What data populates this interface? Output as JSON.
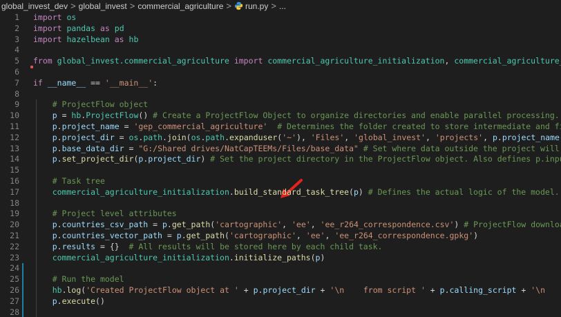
{
  "breadcrumb": {
    "items": [
      "global_invest_dev",
      "global_invest",
      "commercial_agriculture",
      "run.py",
      "..."
    ],
    "separator": ">"
  },
  "editor": {
    "lines": [
      {
        "n": "1",
        "tokens": [
          [
            "kw",
            "import"
          ],
          [
            "pun",
            " "
          ],
          [
            "mod",
            "os"
          ]
        ]
      },
      {
        "n": "2",
        "tokens": [
          [
            "kw",
            "import"
          ],
          [
            "pun",
            " "
          ],
          [
            "mod",
            "pandas"
          ],
          [
            "pun",
            " "
          ],
          [
            "kw",
            "as"
          ],
          [
            "pun",
            " "
          ],
          [
            "mod",
            "pd"
          ]
        ]
      },
      {
        "n": "3",
        "tokens": [
          [
            "kw",
            "import"
          ],
          [
            "pun",
            " "
          ],
          [
            "mod",
            "hazelbean"
          ],
          [
            "pun",
            " "
          ],
          [
            "kw",
            "as"
          ],
          [
            "pun",
            " "
          ],
          [
            "mod",
            "hb"
          ]
        ]
      },
      {
        "n": "4",
        "tokens": []
      },
      {
        "n": "5",
        "tokens": [
          [
            "kw",
            "from"
          ],
          [
            "pun",
            " "
          ],
          [
            "mod",
            "global_invest.commercial_agriculture"
          ],
          [
            "pun",
            " "
          ],
          [
            "kw",
            "import"
          ],
          [
            "pun",
            " "
          ],
          [
            "mod",
            "commercial_agriculture_initialization"
          ],
          [
            "pun",
            ", "
          ],
          [
            "mod",
            "commercial_agriculture_tasks"
          ]
        ]
      },
      {
        "n": "6",
        "tokens": []
      },
      {
        "n": "7",
        "tokens": [
          [
            "kw",
            "if"
          ],
          [
            "pun",
            " "
          ],
          [
            "var",
            "__name__"
          ],
          [
            "pun",
            " == "
          ],
          [
            "str",
            "'__main__'"
          ],
          [
            "pun",
            ":"
          ]
        ]
      },
      {
        "n": "8",
        "tokens": []
      },
      {
        "n": "9",
        "tokens": [
          [
            "pun",
            "    "
          ],
          [
            "cm",
            "# ProjectFlow object"
          ]
        ]
      },
      {
        "n": "10",
        "tokens": [
          [
            "pun",
            "    "
          ],
          [
            "var",
            "p"
          ],
          [
            "pun",
            " = "
          ],
          [
            "mod",
            "hb"
          ],
          [
            "pun",
            "."
          ],
          [
            "cls",
            "ProjectFlow"
          ],
          [
            "pun",
            "() "
          ],
          [
            "cm",
            "# Create a ProjectFlow Object to organize directories and enable parallel processing."
          ]
        ]
      },
      {
        "n": "11",
        "tokens": [
          [
            "pun",
            "    "
          ],
          [
            "var",
            "p"
          ],
          [
            "pun",
            "."
          ],
          [
            "var",
            "project_name"
          ],
          [
            "pun",
            " = "
          ],
          [
            "str",
            "'gep_commercial_agriculture'"
          ],
          [
            "pun",
            "  "
          ],
          [
            "cm",
            "# Determines the folder created to store intermediate and final results."
          ]
        ]
      },
      {
        "n": "12",
        "tokens": [
          [
            "pun",
            "    "
          ],
          [
            "var",
            "p"
          ],
          [
            "pun",
            "."
          ],
          [
            "var",
            "project_dir"
          ],
          [
            "pun",
            " = "
          ],
          [
            "mod",
            "os"
          ],
          [
            "pun",
            "."
          ],
          [
            "mod",
            "path"
          ],
          [
            "pun",
            "."
          ],
          [
            "fn",
            "join"
          ],
          [
            "pun",
            "("
          ],
          [
            "mod",
            "os"
          ],
          [
            "pun",
            "."
          ],
          [
            "mod",
            "path"
          ],
          [
            "pun",
            "."
          ],
          [
            "fn",
            "expanduser"
          ],
          [
            "pun",
            "("
          ],
          [
            "str",
            "'~'"
          ],
          [
            "pun",
            "), "
          ],
          [
            "str",
            "'Files'"
          ],
          [
            "pun",
            ", "
          ],
          [
            "str",
            "'global_invest'"
          ],
          [
            "pun",
            ", "
          ],
          [
            "str",
            "'projects'"
          ],
          [
            "pun",
            ", "
          ],
          [
            "var",
            "p"
          ],
          [
            "pun",
            "."
          ],
          [
            "var",
            "project_name"
          ],
          [
            "pun",
            ") "
          ],
          [
            "cm",
            "# Put it"
          ]
        ]
      },
      {
        "n": "13",
        "tokens": [
          [
            "pun",
            "    "
          ],
          [
            "var",
            "p"
          ],
          [
            "pun",
            "."
          ],
          [
            "var",
            "base_data_dir"
          ],
          [
            "pun",
            " = "
          ],
          [
            "str",
            "\"G:/Shared drives/NatCapTEEMs/Files/base_data\""
          ],
          [
            "pun",
            " "
          ],
          [
            "cm",
            "# Set where data outside the project will be stored."
          ]
        ]
      },
      {
        "n": "14",
        "tokens": [
          [
            "pun",
            "    "
          ],
          [
            "var",
            "p"
          ],
          [
            "pun",
            "."
          ],
          [
            "fn",
            "set_project_dir"
          ],
          [
            "pun",
            "("
          ],
          [
            "var",
            "p"
          ],
          [
            "pun",
            "."
          ],
          [
            "var",
            "project_dir"
          ],
          [
            "pun",
            ") "
          ],
          [
            "cm",
            "# Set the project directory in the ProjectFlow object. Also defines p.input_dir, p"
          ]
        ]
      },
      {
        "n": "15",
        "tokens": []
      },
      {
        "n": "16",
        "tokens": [
          [
            "pun",
            "    "
          ],
          [
            "cm",
            "# Task tree"
          ]
        ]
      },
      {
        "n": "17",
        "tokens": [
          [
            "pun",
            "    "
          ],
          [
            "mod",
            "commercial_agriculture_initialization"
          ],
          [
            "pun",
            "."
          ],
          [
            "fn",
            "build_standard_task_tree"
          ],
          [
            "pun",
            "("
          ],
          [
            "var",
            "p"
          ],
          [
            "pun",
            ") "
          ],
          [
            "cm",
            "# Defines the actual logic of the model. Navigate"
          ]
        ]
      },
      {
        "n": "18",
        "tokens": []
      },
      {
        "n": "19",
        "tokens": [
          [
            "pun",
            "    "
          ],
          [
            "cm",
            "# Project level attributes"
          ]
        ]
      },
      {
        "n": "20",
        "tokens": [
          [
            "pun",
            "    "
          ],
          [
            "var",
            "p"
          ],
          [
            "pun",
            "."
          ],
          [
            "var",
            "countries_csv_path"
          ],
          [
            "pun",
            " = "
          ],
          [
            "var",
            "p"
          ],
          [
            "pun",
            "."
          ],
          [
            "fn",
            "get_path"
          ],
          [
            "pun",
            "("
          ],
          [
            "str",
            "'cartographic'"
          ],
          [
            "pun",
            ", "
          ],
          [
            "str",
            "'ee'"
          ],
          [
            "pun",
            ", "
          ],
          [
            "str",
            "'ee_r264_correspondence.csv'"
          ],
          [
            "pun",
            ") "
          ],
          [
            "cm",
            "# ProjectFlow downloads all f"
          ]
        ]
      },
      {
        "n": "21",
        "tokens": [
          [
            "pun",
            "    "
          ],
          [
            "var",
            "p"
          ],
          [
            "pun",
            "."
          ],
          [
            "var",
            "countries_vector_path"
          ],
          [
            "pun",
            " = "
          ],
          [
            "var",
            "p"
          ],
          [
            "pun",
            "."
          ],
          [
            "fn",
            "get_path"
          ],
          [
            "pun",
            "("
          ],
          [
            "str",
            "'cartographic'"
          ],
          [
            "pun",
            ", "
          ],
          [
            "str",
            "'ee'"
          ],
          [
            "pun",
            ", "
          ],
          [
            "str",
            "'ee_r264_correspondence.gpkg'"
          ],
          [
            "pun",
            ")"
          ]
        ]
      },
      {
        "n": "22",
        "tokens": [
          [
            "pun",
            "    "
          ],
          [
            "var",
            "p"
          ],
          [
            "pun",
            "."
          ],
          [
            "var",
            "results"
          ],
          [
            "pun",
            " = {}  "
          ],
          [
            "cm",
            "# All results will be stored here by each child task."
          ]
        ]
      },
      {
        "n": "23",
        "tokens": [
          [
            "pun",
            "    "
          ],
          [
            "mod",
            "commercial_agriculture_initialization"
          ],
          [
            "pun",
            "."
          ],
          [
            "fn",
            "initialize_paths"
          ],
          [
            "pun",
            "("
          ],
          [
            "var",
            "p"
          ],
          [
            "pun",
            ")"
          ]
        ]
      },
      {
        "n": "24",
        "tokens": []
      },
      {
        "n": "25",
        "tokens": [
          [
            "pun",
            "    "
          ],
          [
            "cm",
            "# Run the model"
          ]
        ]
      },
      {
        "n": "26",
        "tokens": [
          [
            "pun",
            "    "
          ],
          [
            "mod",
            "hb"
          ],
          [
            "pun",
            "."
          ],
          [
            "fn",
            "log"
          ],
          [
            "pun",
            "("
          ],
          [
            "str",
            "'Created ProjectFlow object at '"
          ],
          [
            "pun",
            " + "
          ],
          [
            "var",
            "p"
          ],
          [
            "pun",
            "."
          ],
          [
            "var",
            "project_dir"
          ],
          [
            "pun",
            " + "
          ],
          [
            "str",
            "'\\n    from script '"
          ],
          [
            "pun",
            " + "
          ],
          [
            "var",
            "p"
          ],
          [
            "pun",
            "."
          ],
          [
            "var",
            "calling_script"
          ],
          [
            "pun",
            " + "
          ],
          [
            "str",
            "'\\n    with base"
          ]
        ]
      },
      {
        "n": "27",
        "tokens": [
          [
            "pun",
            "    "
          ],
          [
            "var",
            "p"
          ],
          [
            "pun",
            "."
          ],
          [
            "fn",
            "execute"
          ],
          [
            "pun",
            "()"
          ]
        ]
      },
      {
        "n": "28",
        "tokens": []
      }
    ]
  },
  "colors": {
    "background": "#1e1e1e",
    "keyword": "#c586c0",
    "string": "#ce9178",
    "comment": "#6a9955",
    "annotation_arrow": "#e0251f"
  },
  "icons": {
    "file_icon": "python-file-icon",
    "annotation": "red-arrow-icon"
  }
}
